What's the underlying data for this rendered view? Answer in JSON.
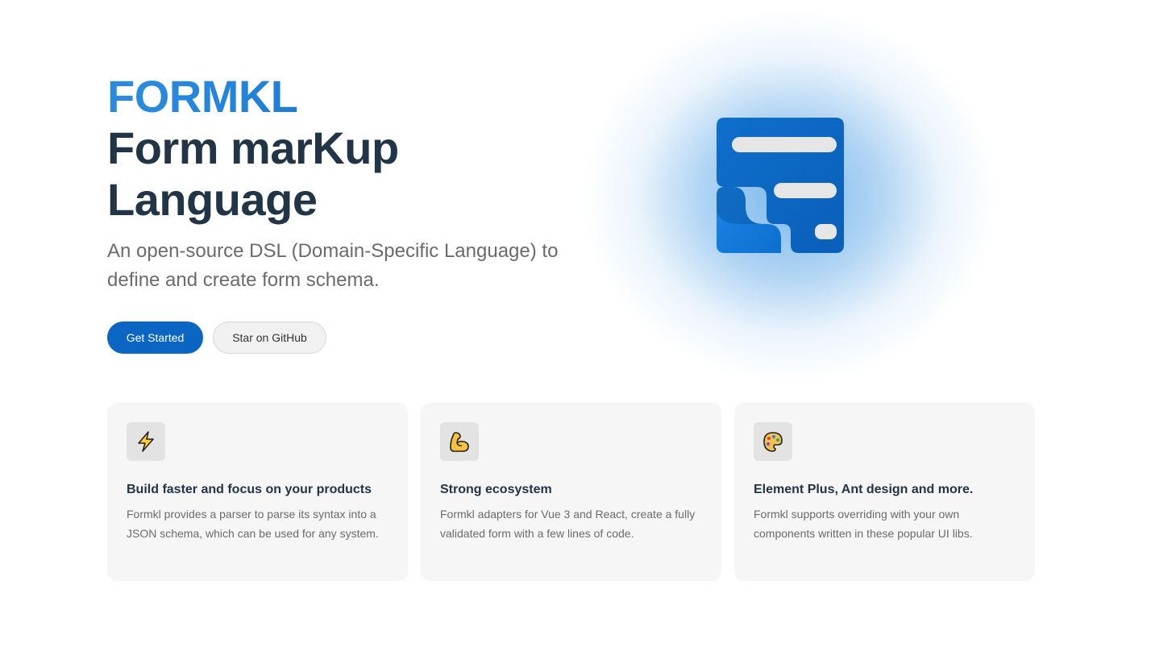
{
  "hero": {
    "name": "FORMKL",
    "text": "Form marKup Language",
    "tagline": "An open-source DSL (Domain-Specific Language) to define and create form schema.",
    "actions": {
      "primary": "Get Started",
      "secondary": "Star on GitHub"
    }
  },
  "features": [
    {
      "icon": "lightning-icon",
      "title": "Build faster and focus on your products",
      "details": "Formkl provides a parser to parse its syntax into a JSON schema, which can be used for any system."
    },
    {
      "icon": "flexed-biceps-icon",
      "title": "Strong ecosystem",
      "details": "Formkl adapters for Vue 3 and React, create a fully validated form with a few lines of code."
    },
    {
      "icon": "palette-icon",
      "title": "Element Plus, Ant design and more.",
      "details": "Formkl supports overriding with your own components written in these popular UI libs."
    }
  ],
  "colors": {
    "brand": "#0a66c2",
    "text": "#213547",
    "muted": "#6b6b6b"
  }
}
